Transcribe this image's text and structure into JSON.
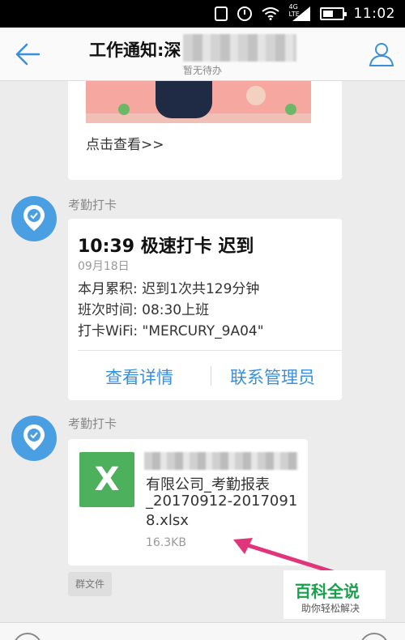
{
  "status_bar": {
    "time": "11:02",
    "network": "4G LTE"
  },
  "header": {
    "title": "工作通知:深",
    "subtitle": "暂无待办"
  },
  "message1": {
    "see_more": "点击查看>>"
  },
  "message2": {
    "sender": "考勤打卡",
    "title": "10:39 极速打卡 迟到",
    "date": "09月18日",
    "line1": "本月累积: 迟到1次共129分钟",
    "line2": "班次时间: 08:30上班",
    "line3": "打卡WiFi: \"MERCURY_9A04\"",
    "button_details": "查看详情",
    "button_contact": "联系管理员"
  },
  "message3": {
    "sender": "考勤打卡",
    "file_icon_letter": "X",
    "file_name_line1": "有限公司_考勤报表",
    "file_name_line2": "_20170912-2017091",
    "file_name_line3": "8.xlsx",
    "file_size": "16.3KB",
    "group_file": "群文件"
  },
  "watermark": {
    "main": "百科全说",
    "sub": "助你轻松解决"
  },
  "colors": {
    "accent": "#3a8fd9",
    "avatar": "#4a9fe2",
    "excel": "#4cb05d",
    "arrow": "#e0357a"
  }
}
